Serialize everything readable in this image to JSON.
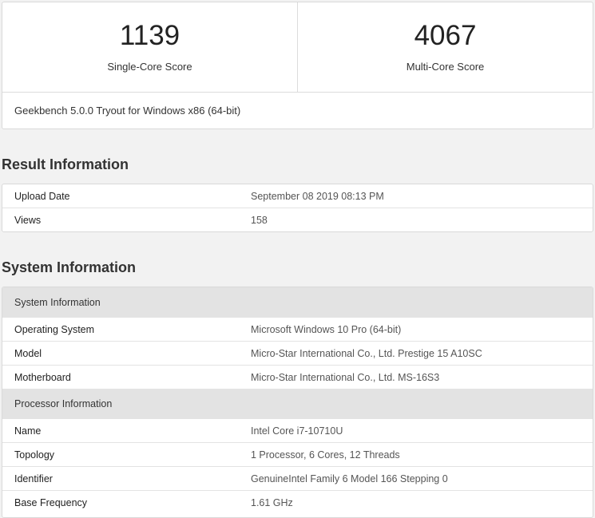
{
  "scores": {
    "single_core": {
      "value": "1139",
      "label": "Single-Core Score"
    },
    "multi_core": {
      "value": "4067",
      "label": "Multi-Core Score"
    },
    "version": "Geekbench 5.0.0 Tryout for Windows x86 (64-bit)"
  },
  "result_info": {
    "title": "Result Information",
    "rows": [
      {
        "key": "Upload Date",
        "value": "September 08 2019 08:13 PM"
      },
      {
        "key": "Views",
        "value": "158"
      }
    ]
  },
  "system_info": {
    "title": "System Information",
    "groups": [
      {
        "heading": "System Information",
        "rows": [
          {
            "key": "Operating System",
            "value": "Microsoft Windows 10 Pro (64-bit)"
          },
          {
            "key": "Model",
            "value": "Micro-Star International Co., Ltd. Prestige 15 A10SC"
          },
          {
            "key": "Motherboard",
            "value": "Micro-Star International Co., Ltd. MS-16S3"
          }
        ]
      },
      {
        "heading": "Processor Information",
        "rows": [
          {
            "key": "Name",
            "value": "Intel Core i7-10710U"
          },
          {
            "key": "Topology",
            "value": "1 Processor, 6 Cores, 12 Threads"
          },
          {
            "key": "Identifier",
            "value": "GenuineIntel Family 6 Model 166 Stepping 0"
          },
          {
            "key": "Base Frequency",
            "value": "1.61 GHz"
          }
        ]
      }
    ]
  }
}
